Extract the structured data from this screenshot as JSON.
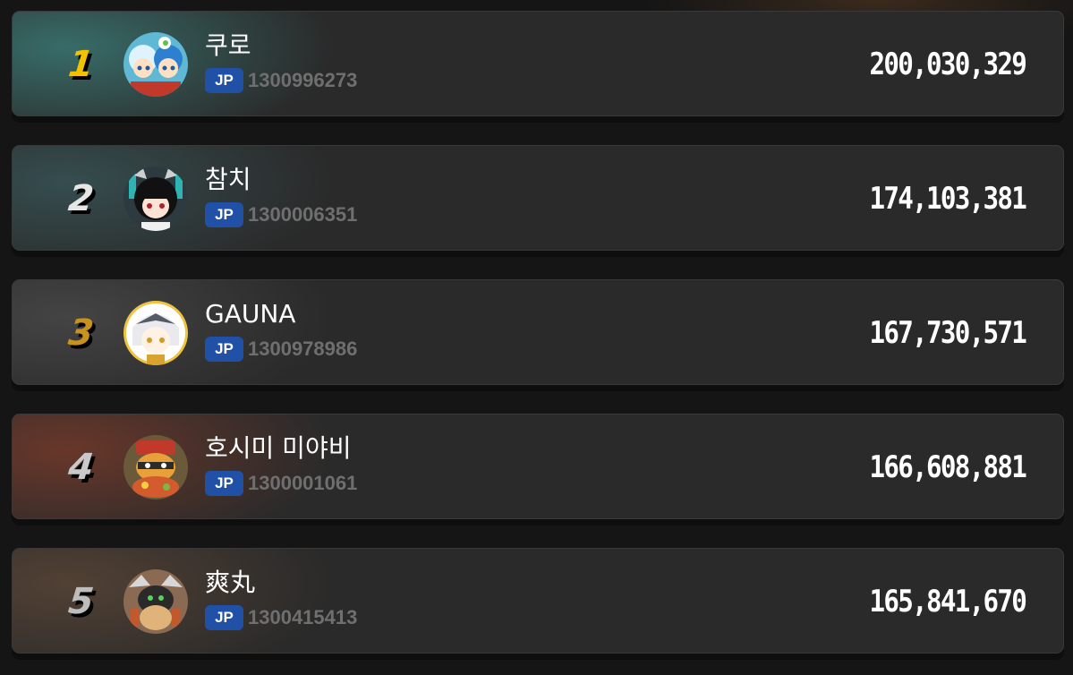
{
  "leaderboard": {
    "entries": [
      {
        "rank": "1",
        "name": "쿠로",
        "region": "JP",
        "uid": "1300996273",
        "score": "200,030,329",
        "rank_color": "#f2c200",
        "glow_color": "#2f6160"
      },
      {
        "rank": "2",
        "name": "참치",
        "region": "JP",
        "uid": "1300006351",
        "score": "174,103,381",
        "rank_color": "#e6e6e6",
        "glow_color": "#304f52"
      },
      {
        "rank": "3",
        "name": "GAUNA",
        "region": "JP",
        "uid": "1300978986",
        "score": "167,730,571",
        "rank_color": "#c7921e",
        "glow_color": "#474747"
      },
      {
        "rank": "4",
        "name": "호시미 미야비",
        "region": "JP",
        "uid": "1300001061",
        "score": "166,608,881",
        "rank_color": "#c9c9c9",
        "glow_color": "#6a3a2e"
      },
      {
        "rank": "5",
        "name": "爽丸",
        "region": "JP",
        "uid": "1300415413",
        "score": "165,841,670",
        "rank_color": "#bdbdbd",
        "glow_color": "#4f3e32"
      }
    ]
  }
}
